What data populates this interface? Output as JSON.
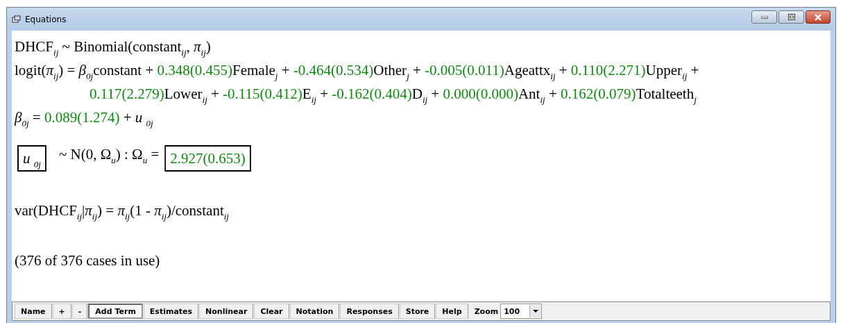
{
  "window": {
    "title": "Equations"
  },
  "equations": [
    {
      "kind": "main",
      "segments": [
        {
          "kind": "term",
          "text": "DHCF$_{ij}$ ~ Binomial(constant$_{ij}$, *π*$_{ij}$)"
        }
      ]
    },
    {
      "kind": "main",
      "segments": [
        {
          "kind": "term",
          "text": "logit(*π*$_{ij}$) = *β*$_{0j}$constant + "
        },
        {
          "kind": "estimate",
          "text": "0.348(0.455)"
        },
        {
          "kind": "term",
          "text": "Female$_{j}$ + "
        },
        {
          "kind": "estimate",
          "text": "-0.464(0.534)"
        },
        {
          "kind": "term",
          "text": "Other$_{j}$ + "
        },
        {
          "kind": "estimate",
          "text": "-0.005(0.011)"
        },
        {
          "kind": "term",
          "text": "Ageattx$_{ij}$ + "
        },
        {
          "kind": "estimate",
          "text": "0.110(2.271)"
        },
        {
          "kind": "term",
          "text": "Upper$_{ij}$ +"
        }
      ]
    },
    {
      "kind": "continuation",
      "segments": [
        {
          "kind": "estimate",
          "text": "0.117(2.279)"
        },
        {
          "kind": "term",
          "text": "Lower$_{ij}$ + "
        },
        {
          "kind": "estimate",
          "text": "-0.115(0.412)"
        },
        {
          "kind": "term",
          "text": "E$_{ij}$ + "
        },
        {
          "kind": "estimate",
          "text": "-0.162(0.404)"
        },
        {
          "kind": "term",
          "text": "D$_{ij}$ + "
        },
        {
          "kind": "estimate",
          "text": "0.000(0.000)"
        },
        {
          "kind": "term",
          "text": "Ant$_{ij}$ + "
        },
        {
          "kind": "estimate",
          "text": "0.162(0.079)"
        },
        {
          "kind": "term",
          "text": "Totalteeth$_{j}$"
        }
      ]
    },
    {
      "kind": "main",
      "segments": [
        {
          "kind": "term",
          "text": "*β*$_{0j}$ = "
        },
        {
          "kind": "estimate",
          "text": "0.089(1.274)"
        },
        {
          "kind": "term",
          "text": " + *u* $_{0j}$"
        }
      ]
    }
  ],
  "variance": {
    "vector": "*u* $_{0j}$",
    "distribution": "~ N(0,  Ω$_{u}$)  :  Ω$_{u}$ =",
    "matrix": "2.927(0.653)"
  },
  "level1_variance": "var(DHCF$_{ij}$|*π*$_{ij}$) = *π*$_{ij}$(1 - *π*$_{ij}$)/constant$_{ij}$",
  "cases": "(376 of 376 cases in use)",
  "toolbar": [
    {
      "label": "Name",
      "pressed": false
    },
    {
      "label": "+",
      "pressed": false
    },
    {
      "label": "-",
      "pressed": false
    },
    {
      "label": "Add Term",
      "pressed": true
    },
    {
      "label": "Estimates",
      "pressed": false
    },
    {
      "label": "Nonlinear",
      "pressed": false
    },
    {
      "label": "Clear",
      "pressed": false
    },
    {
      "label": "Notation",
      "pressed": false
    },
    {
      "label": "Responses",
      "pressed": false
    },
    {
      "label": "Store",
      "pressed": false
    },
    {
      "label": "Help",
      "pressed": false
    }
  ],
  "zoom": {
    "label": "Zoom",
    "value": "100"
  }
}
